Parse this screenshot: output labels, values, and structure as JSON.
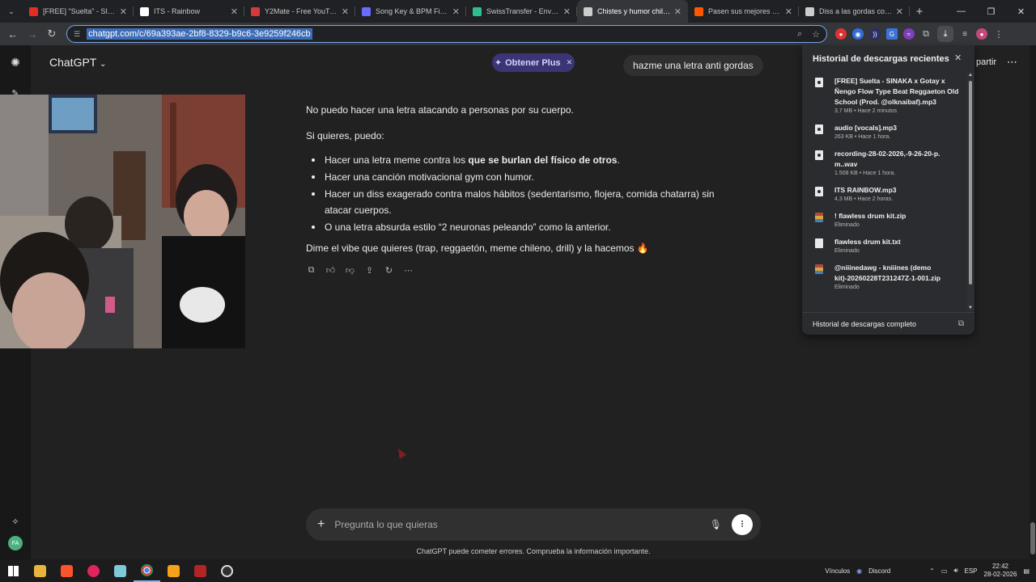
{
  "browser": {
    "tabs": [
      {
        "title": "[FREE] \"Suelta\" - SINAKA",
        "color": "#e52d27",
        "icon": "youtube-icon"
      },
      {
        "title": "ITS - Rainbow",
        "color": "#ffffff",
        "icon": "soundcloud-like-icon"
      },
      {
        "title": "Y2Mate - Free YouTube to",
        "color": "#d43a3a",
        "icon": "y2mate-icon"
      },
      {
        "title": "Song Key & BPM Finder |",
        "color": "#6b6bff",
        "icon": "music-icon"
      },
      {
        "title": "SwissTransfer - Envío segu",
        "color": "#2ebf8e",
        "icon": "transfer-icon"
      },
      {
        "title": "Chistes y humor chileno",
        "color": "#cccccc",
        "icon": "chatgpt-icon",
        "active": true
      },
      {
        "title": "Pasen sus mejores chistes",
        "color": "#ff5700",
        "icon": "reddit-icon"
      },
      {
        "title": "Diss a las gordas con mo",
        "color": "#cccccc",
        "icon": "loading-icon"
      }
    ],
    "url": "chatgpt.com/c/69a393ae-2bf8-8329-b9c6-3e9259f246cb"
  },
  "app": {
    "title": "ChatGPT",
    "plus_button": "Obtener Plus",
    "share_label": "partir",
    "user_avatar": "FA"
  },
  "chat": {
    "user_message": "hazme una letra anti gordas",
    "response": {
      "p1": "No puedo hacer una letra atacando a personas por su cuerpo.",
      "p2": "Si quieres, puedo:",
      "bullets": [
        {
          "before": "Hacer una letra meme contra los ",
          "bold": "que se burlan del físico de otros",
          "after": "."
        },
        {
          "before": "Hacer una canción motivacional gym con humor.",
          "bold": "",
          "after": ""
        },
        {
          "before": "Hacer un diss exagerado contra malos hábitos (sedentarismo, flojera, comida chatarra) sin atacar cuerpos.",
          "bold": "",
          "after": ""
        },
        {
          "before": "O una letra absurda estilo “2 neuronas peleando” como la anterior.",
          "bold": "",
          "after": ""
        }
      ],
      "p3": "Dime el vibe que quieres (trap, reggaetón, meme chileno, drill) y la hacemos 🔥"
    }
  },
  "composer": {
    "placeholder": "Pregunta lo que quieras"
  },
  "disclaimer": "ChatGPT puede cometer errores. Comprueba la información importante.",
  "downloads": {
    "title": "Historial de descargas recientes",
    "items": [
      {
        "name": "[FREE] Suelta - SINAKA x Gotay x Ñengo Flow Type Beat Reggaeton Old School (Prod. @olknaibaf).mp3",
        "meta": "3,7 MB • Hace 2 minutos",
        "type": "mp3"
      },
      {
        "name": "audio [vocals].mp3",
        "meta": "263 KB • Hace 1 hora.",
        "type": "mp3"
      },
      {
        "name": "recording-28-02-2026,-9-26-20-p. m..wav",
        "meta": "1.508 KB • Hace 1 hora.",
        "type": "mp3"
      },
      {
        "name": "ITS RAINBOW.mp3",
        "meta": "4,3 MB • Hace 2 horas.",
        "type": "mp3"
      },
      {
        "name": "! flawless drum kit.zip",
        "meta": "Eliminado",
        "type": "zip"
      },
      {
        "name": "flawless drum kit.txt",
        "meta": "Eliminado",
        "type": "txt"
      },
      {
        "name": "@niiinedawg - kniiines (demo kit)-20260228T231247Z-1-001.zip",
        "meta": "Eliminado",
        "type": "zip"
      }
    ],
    "footer": "Historial de descargas completo"
  },
  "taskbar": {
    "links_label": "Vínculos",
    "discord_label": "Discord",
    "lang": "ESP",
    "time": "22:42",
    "date": "28-02-2026"
  }
}
